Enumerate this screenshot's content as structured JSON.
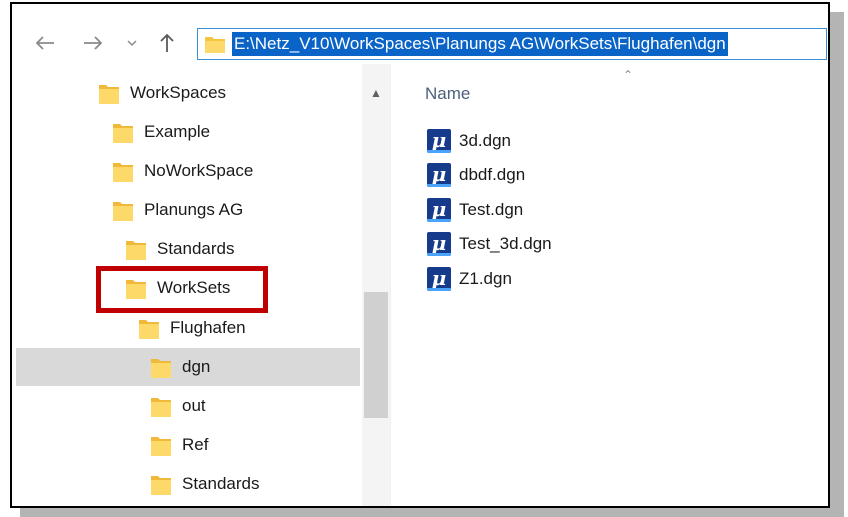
{
  "window": {
    "address_path": "E:\\Netz_V10\\WorkSpaces\\Planungs AG\\WorkSets\\Flughafen\\dgn"
  },
  "icons": {
    "back": "arrow-left-icon",
    "forward": "arrow-right-icon",
    "recent": "chevron-down-icon",
    "up": "arrow-up-icon",
    "folder": "folder-icon",
    "file": "microstation-file-icon"
  },
  "colors": {
    "selection": "#0a64c8",
    "highlight_box": "#c00000",
    "file_icon": "#163a8c",
    "folder": "#f5c542"
  },
  "tree": {
    "items": [
      {
        "label": "WorkSpaces",
        "level": 0,
        "selected": false
      },
      {
        "label": "Example",
        "level": 1,
        "selected": false
      },
      {
        "label": "NoWorkSpace",
        "level": 1,
        "selected": false
      },
      {
        "label": "Planungs AG",
        "level": 1,
        "selected": false
      },
      {
        "label": "Standards",
        "level": 2,
        "selected": false
      },
      {
        "label": "WorkSets",
        "level": 2,
        "selected": false,
        "highlighted": true
      },
      {
        "label": "Flughafen",
        "level": 3,
        "selected": false
      },
      {
        "label": "dgn",
        "level": 4,
        "selected": true
      },
      {
        "label": "out",
        "level": 4,
        "selected": false
      },
      {
        "label": "Ref",
        "level": 4,
        "selected": false
      },
      {
        "label": "Standards",
        "level": 4,
        "selected": false
      }
    ]
  },
  "files": {
    "column_header": "Name",
    "items": [
      {
        "name": "3d.dgn"
      },
      {
        "name": "dbdf.dgn"
      },
      {
        "name": "Test.dgn"
      },
      {
        "name": "Test_3d.dgn"
      },
      {
        "name": "Z1.dgn"
      }
    ]
  }
}
